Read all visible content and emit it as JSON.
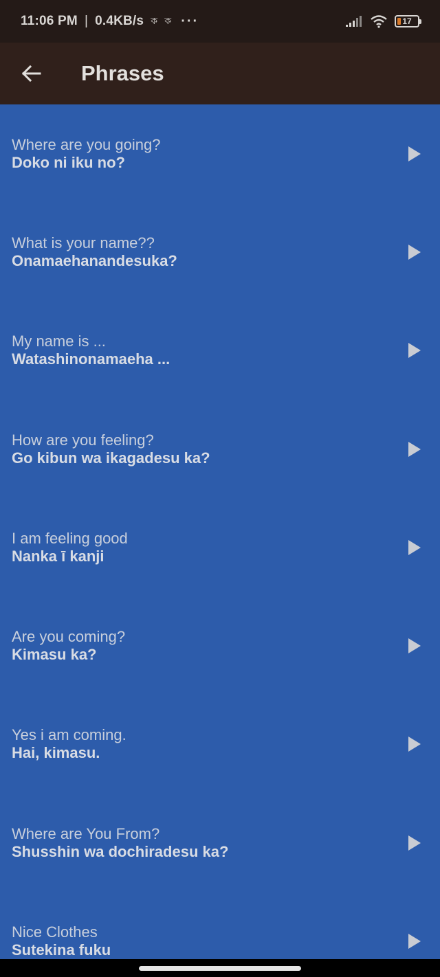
{
  "status_bar": {
    "time": "11:06 PM",
    "separator": "|",
    "speed": "0.4KB/s",
    "notifications": [
      "ক",
      "ক"
    ],
    "more": "···",
    "battery": "17"
  },
  "app_bar": {
    "title": "Phrases",
    "back_icon": "arrow-back-icon"
  },
  "phrases": [
    {
      "en": "Where are you going?",
      "jp": "Doko ni iku no?"
    },
    {
      "en": "What is your name??",
      "jp": "Onamaehanandesuka?"
    },
    {
      "en": "My name is ...",
      "jp": "Watashinonamaeha ..."
    },
    {
      "en": "How are you feeling?",
      "jp": "Go kibun wa ikagadesu ka?"
    },
    {
      "en": "I am feeling good",
      "jp": "Nanka ī kanji"
    },
    {
      "en": "Are you coming?",
      "jp": "Kimasu ka?"
    },
    {
      "en": "Yes i am coming.",
      "jp": "Hai, kimasu."
    },
    {
      "en": "Where are You From?",
      "jp": "Shusshin wa dochiradesu ka?"
    },
    {
      "en": "Nice Clothes",
      "jp": "Sutekina fuku"
    }
  ],
  "colors": {
    "list_background": "#2d5cab",
    "app_bar": "#30201b",
    "status_bar": "#241a17",
    "play_icon": "#c9ccd3"
  }
}
